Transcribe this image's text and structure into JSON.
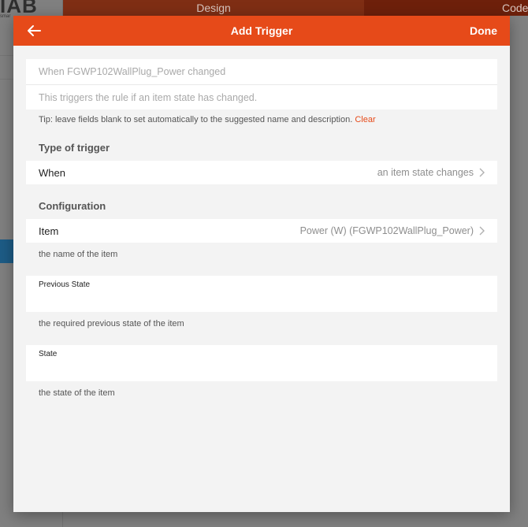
{
  "background": {
    "logo_text": "IAB",
    "logo_subtext": "smar",
    "tabs": [
      {
        "label": "Design"
      },
      {
        "label": "Code"
      }
    ]
  },
  "navbar": {
    "title": "Add Trigger",
    "done_label": "Done",
    "back_icon": "arrow-left-icon"
  },
  "name_card": {
    "name_placeholder": "When FGWP102WallPlug_Power changed",
    "description_placeholder": "This triggers the rule if an item state has changed."
  },
  "tip": {
    "text": "Tip: leave fields blank to set automatically to the suggested name and description.",
    "clear_label": "Clear"
  },
  "trigger_type": {
    "section_title": "Type of trigger",
    "row_label": "When",
    "row_value": "an item state changes"
  },
  "configuration": {
    "section_title": "Configuration",
    "item": {
      "label": "Item",
      "value": "Power (W) (FGWP102WallPlug_Power)",
      "hint": "the name of the item"
    },
    "previous_state": {
      "label": "Previous State",
      "value": "",
      "hint": "the required previous state of the item"
    },
    "state": {
      "label": "State",
      "value": "",
      "hint": "the state of the item"
    }
  },
  "colors": {
    "accent": "#e64a19",
    "modal_bg": "#f3f3f3"
  }
}
